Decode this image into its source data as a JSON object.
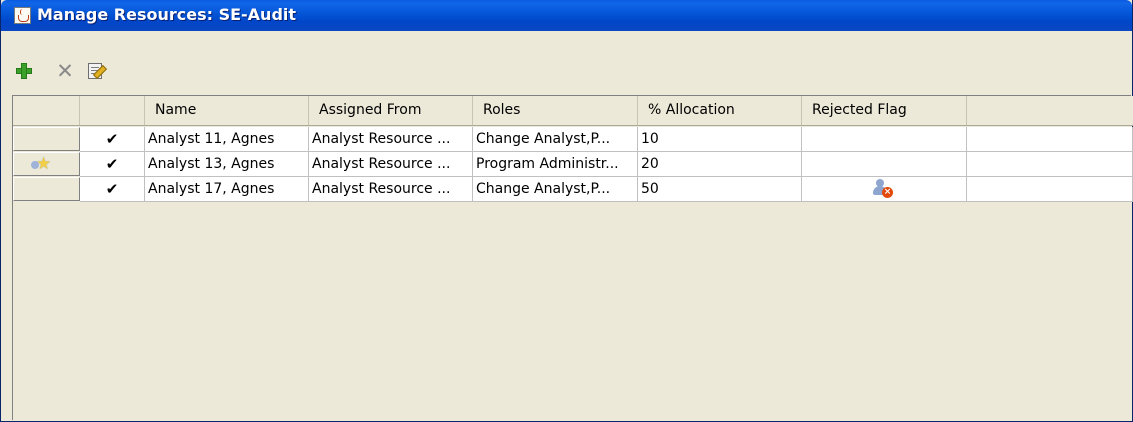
{
  "window": {
    "title": "Manage Resources: SE-Audit",
    "icon": "java-cup-icon"
  },
  "toolbar": {
    "add_icon": "add-icon",
    "delete_icon": "delete-icon",
    "edit_icon": "edit-icon",
    "delete_glyph": "✕"
  },
  "table": {
    "columns": [
      "",
      "",
      "Name",
      "Assigned From",
      "Roles",
      "% Allocation",
      "Rejected Flag",
      ""
    ],
    "rows": [
      {
        "row_icon": "",
        "check": "✔",
        "name": "Analyst 11, Agnes",
        "assigned_from": "Analyst Resource ...",
        "roles": "Change Analyst,P...",
        "allocation": "10",
        "rejected": ""
      },
      {
        "row_icon": "star-person-icon",
        "check": "✔",
        "name": "Analyst 13, Agnes",
        "assigned_from": "Analyst Resource ...",
        "roles": "Program Administr...",
        "allocation": "20",
        "rejected": ""
      },
      {
        "row_icon": "",
        "check": "✔",
        "name": "Analyst 17, Agnes",
        "assigned_from": "Analyst Resource ...",
        "roles": "Change Analyst,P...",
        "allocation": "50",
        "rejected": "rejected-user-icon"
      }
    ]
  }
}
